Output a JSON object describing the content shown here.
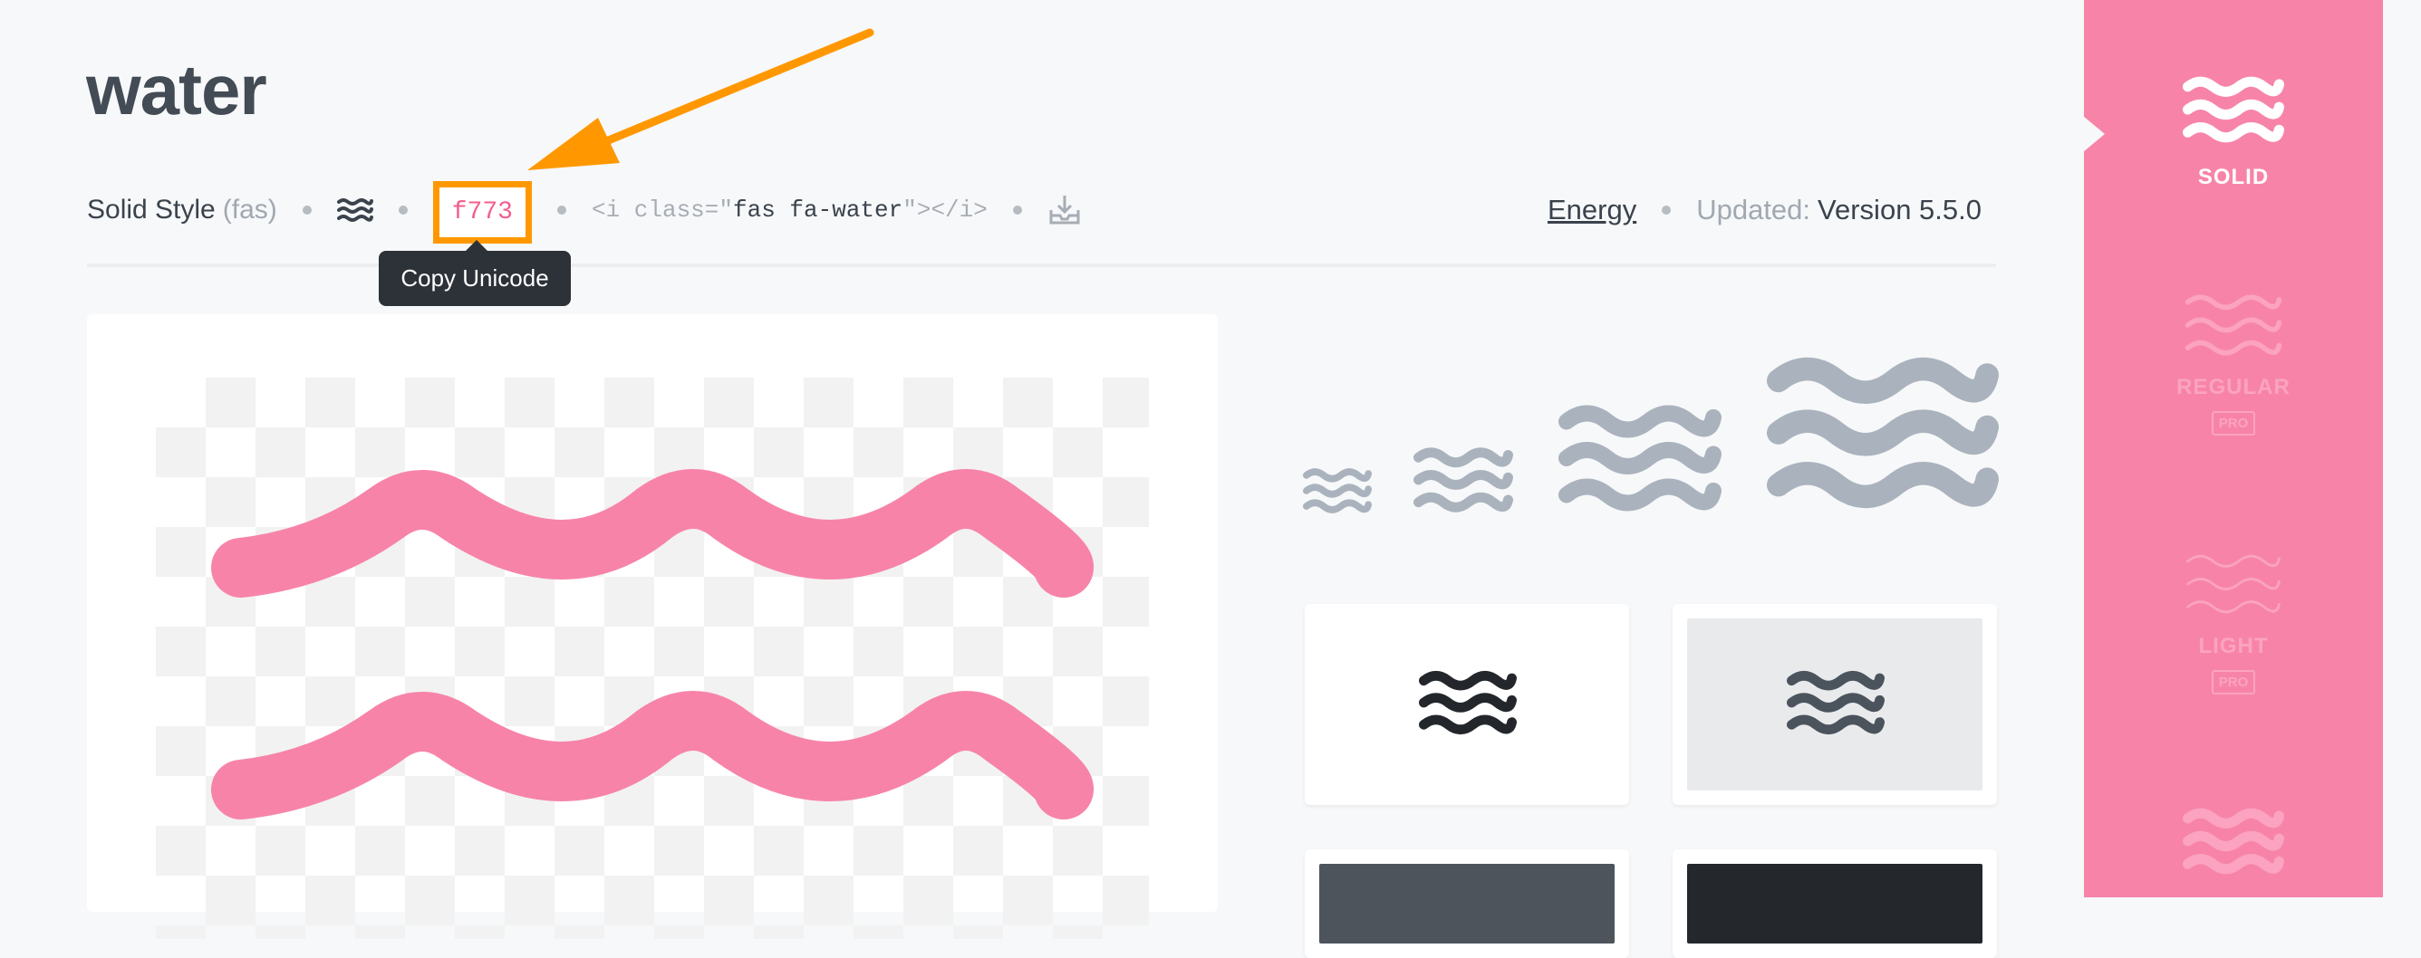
{
  "page": {
    "title": "water"
  },
  "meta": {
    "style_label": "Solid Style",
    "style_prefix": "(fas)",
    "unicode": "f773",
    "code_open": "<i class=\"",
    "code_class": "fas fa-water",
    "code_close": "\"></i>",
    "category": "Energy",
    "updated_label": "Updated:",
    "updated_value": "Version 5.5.0"
  },
  "tooltip": {
    "text": "Copy Unicode"
  },
  "sidebar": {
    "options": [
      {
        "label": "SOLID",
        "active": true,
        "pro": ""
      },
      {
        "label": "REGULAR",
        "active": false,
        "pro": "PRO"
      },
      {
        "label": "LIGHT",
        "active": false,
        "pro": "PRO"
      }
    ]
  },
  "colors": {
    "brand_pink": "#f784a8",
    "icon_pink": "#f784a8",
    "icon_gray": "#aab3bd",
    "highlight_orange": "#ff9800"
  },
  "icons": {
    "water": "water-icon",
    "download": "download-icon",
    "arrow": "annotation-arrow"
  }
}
